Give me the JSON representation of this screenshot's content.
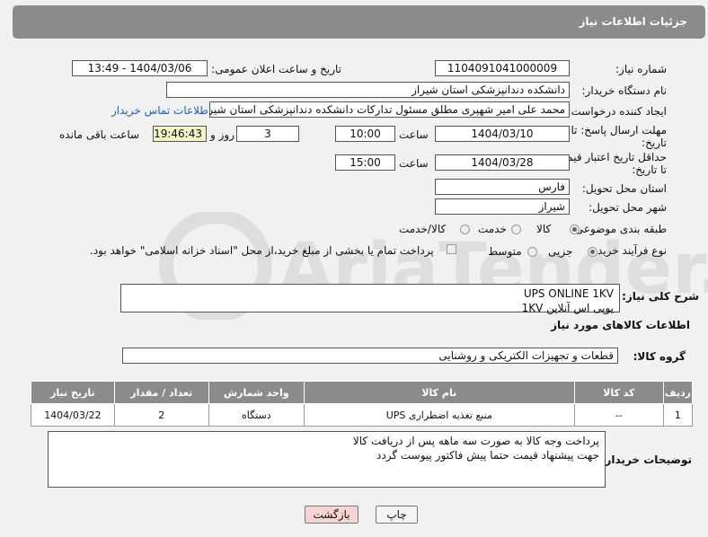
{
  "header": {
    "title": "جزئیات اطلاعات نیاز"
  },
  "fields": {
    "need_number_label": "شماره نیاز:",
    "need_number": "1104091041000009",
    "announce_label": "تاریخ و ساعت اعلان عمومی:",
    "announce_value": "1404/03/06 - 13:49",
    "buyer_label": "نام دستگاه خریدار:",
    "buyer": "دانشکده دندانپزشکی استان شیراز",
    "creator_label": "ایجاد کننده درخواست:",
    "creator": "محمد علی امیر شهپری مطلق مسئول تدارکات دانشکده دندانپزشکی استان شیراز",
    "contact_link": "اطلاعات تماس خریدار",
    "deadline_label_1": "مهلت ارسال پاسخ: تا",
    "deadline_label_2": "تاریخ:",
    "deadline_date": "1404/03/10",
    "time_word": "ساعت",
    "deadline_time": "10:00",
    "days": "3",
    "days_suffix": "روز و",
    "remaining_time": "19:46:43",
    "remaining_suffix": "ساعت باقی مانده",
    "validity_label_1": "حداقل تاریخ اعتبار قیمت:",
    "validity_label_2": "تا تاریخ:",
    "validity_date": "1404/03/28",
    "validity_time": "15:00",
    "province_label": "استان محل تحویل:",
    "province": "فارس",
    "city_label": "شهر محل تحویل:",
    "city": "شیراز",
    "category_label": "طبقه بندی موضوعی:",
    "category_options": [
      "کالا",
      "خدمت",
      "کالا/خدمت"
    ],
    "process_label": "نوع فرآیند خرید :",
    "process_options": [
      "جزیی",
      "متوسط"
    ],
    "payment_note": "پرداخت تمام یا بخشی از مبلغ خرید،از محل \"اسناد خزانه اسلامی\" خواهد بود."
  },
  "summary": {
    "label": "شرح کلی نیاز:",
    "text": "UPS ONLINE  1KV\nیوپی اس  آنلاین  1KV"
  },
  "goods": {
    "section_title": "اطلاعات کالاهای مورد نیاز",
    "group_label": "گروه کالا:",
    "group_value": "قطعات و تجهیزات الکتریکی و روشنایی",
    "columns": [
      "ردیف",
      "کد کالا",
      "نام کالا",
      "واحد شمارش",
      "تعداد / مقدار",
      "تاریخ نیاز"
    ],
    "rows": [
      [
        "1",
        "--",
        "منبع تغذیه اضطراری UPS",
        "دستگاه",
        "2",
        "1404/03/22"
      ]
    ]
  },
  "buyer_notes": {
    "label": "توضیحات خریدار:",
    "text": "پرداخت وجه کالا به صورت سه ماهه پس از دریافت کالا\nجهت پیشنهاد قیمت حتما پیش فاکتور پیوست گردد"
  },
  "buttons": {
    "print": "چاپ",
    "back": "بازگشت"
  },
  "watermark_text": "AriaTender.neT",
  "colors": {
    "header_bg": "#8b8b8b",
    "link": "#1f5fb0",
    "back_button_bg": "#f7d4d4"
  }
}
